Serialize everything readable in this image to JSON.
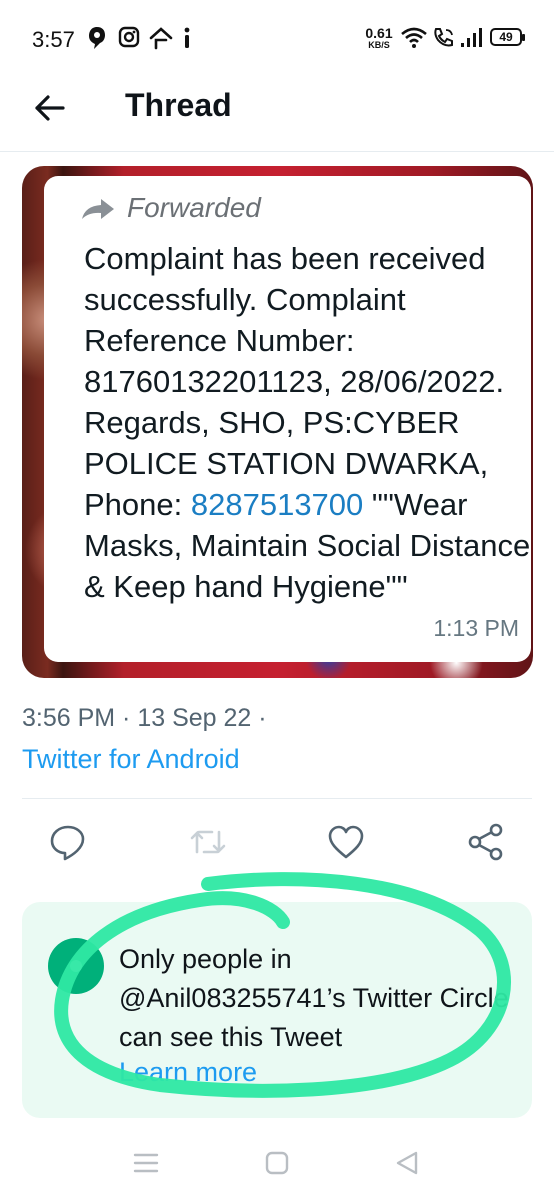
{
  "status_bar": {
    "time": "3:57",
    "net_speed_value": "0.61",
    "net_speed_unit": "KB/S",
    "battery": "49",
    "icons": [
      "signal-app-icon",
      "instagram-icon",
      "swipe-icon",
      "info-icon",
      "wifi-icon",
      "call-icon",
      "cell-signal-icon",
      "battery-icon"
    ]
  },
  "header": {
    "title": "Thread",
    "back_icon": "arrow-left-icon"
  },
  "media": {
    "forwarded_label": "Forwarded",
    "message_before_link": "Complaint has been received successfully. Complaint Reference Number: 81760132201123, 28/06/2022. Regards, SHO, PS:CYBER POLICE STATION DWARKA, Phone: ",
    "message_link": "8287513700",
    "message_after_link": " \"\"Wear Masks, Maintain Social Distance & Keep hand Hygiene\"\"",
    "message_time": "1:13 PM"
  },
  "tweet": {
    "timestamp": "3:56 PM · 13 Sep 22 ·",
    "source": "Twitter for Android"
  },
  "actions": [
    {
      "name": "reply-icon"
    },
    {
      "name": "retweet-icon",
      "disabled": true
    },
    {
      "name": "like-icon"
    },
    {
      "name": "share-icon"
    }
  ],
  "circle_notice": {
    "text": "Only people in @Anil083255741’s Twitter Circle can see this Tweet",
    "link": "Learn more"
  },
  "colors": {
    "accent": "#1d9bf0",
    "circle_green": "#00b07a",
    "marker_green": "#2ee8a3",
    "card_bg": "#eafaf3"
  }
}
